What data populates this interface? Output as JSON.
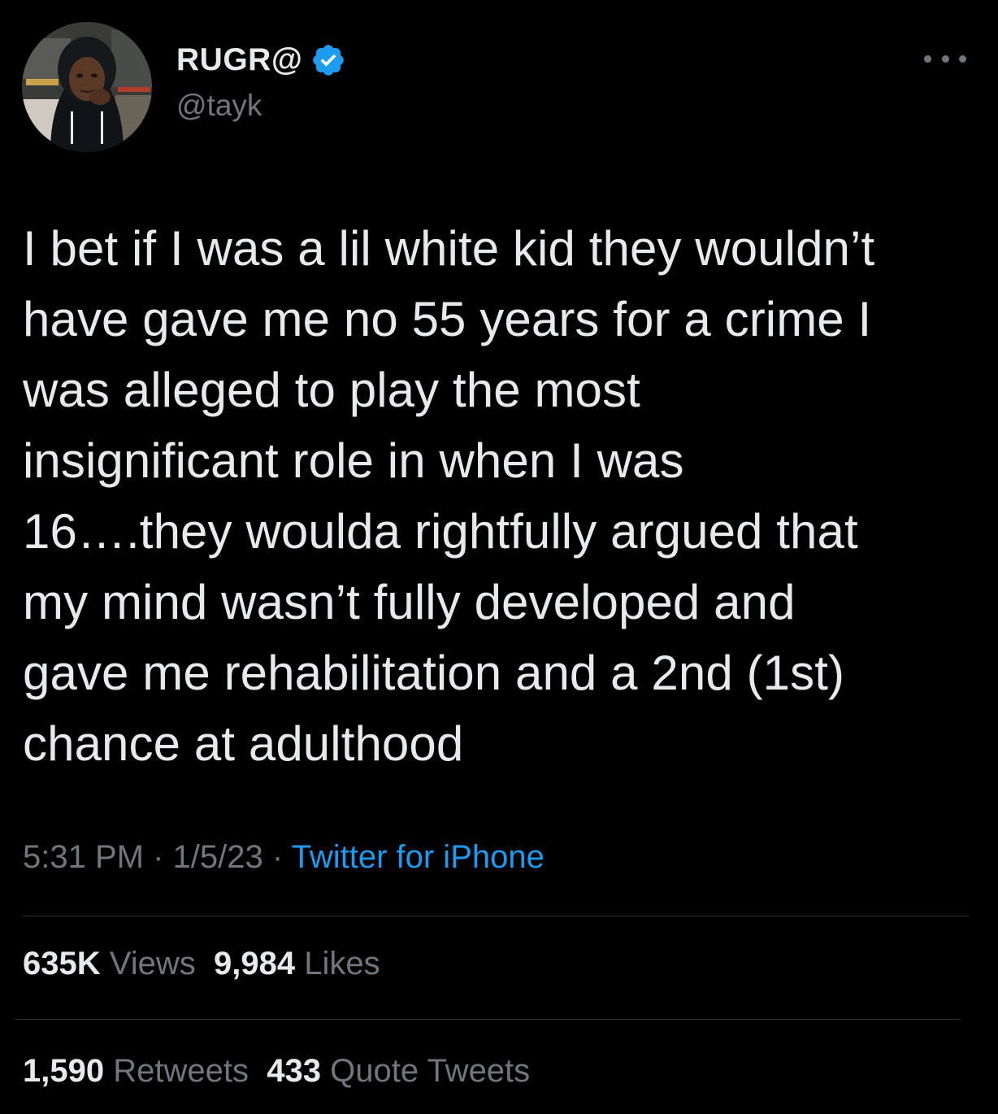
{
  "colors": {
    "background": "#000000",
    "primary_text": "#e7e9ea",
    "secondary_text": "#71767b",
    "link": "#1d9bf0",
    "verified_badge": "#1d9bf0",
    "divider": "#2f3336"
  },
  "author": {
    "display_name": "RUGR@",
    "handle": "@tayk",
    "verified": true,
    "verified_icon": "verified-badge-icon",
    "avatar_icon": "avatar-photo"
  },
  "more_icon": "ellipsis-icon",
  "tweet": {
    "text": "I bet if I was a lil white kid they wouldn’t\nhave gave me no 55 years for a crime I\nwas alleged to play the most\ninsignificant role in when I was\n16….they woulda rightfully argued that\nmy mind wasn’t fully developed and\ngave me rehabilitation and a 2nd (1st)\nchance at adulthood"
  },
  "meta": {
    "time": "5:31 PM",
    "separator": "·",
    "date": "1/5/23",
    "source": "Twitter for iPhone"
  },
  "stats": {
    "views_count": "635K",
    "views_label": "Views",
    "likes_count": "9,984",
    "likes_label": "Likes",
    "retweets_count": "1,590",
    "retweets_label": "Retweets",
    "quotes_count": "433",
    "quotes_label": "Quote Tweets"
  }
}
